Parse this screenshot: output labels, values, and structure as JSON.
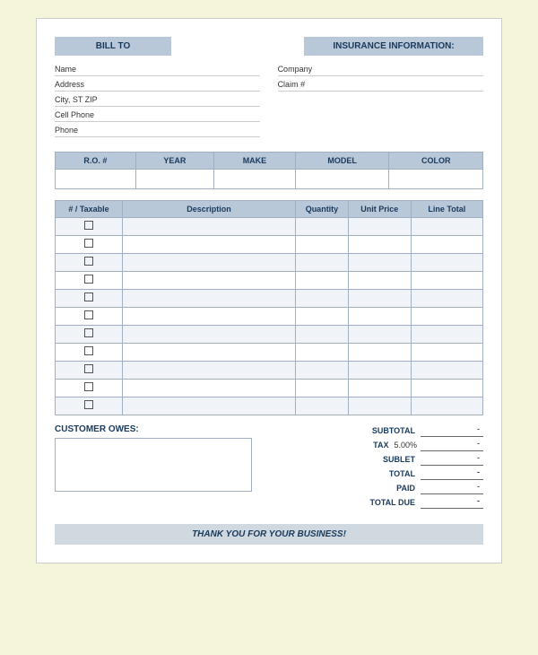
{
  "header": {
    "bill_to_label": "BILL TO",
    "insurance_label": "INSURANCE INFORMATION:"
  },
  "bill_to_fields": [
    {
      "label": "Name"
    },
    {
      "label": "Address"
    },
    {
      "label": "City, ST ZIP"
    },
    {
      "label": "Cell Phone"
    },
    {
      "label": "Phone"
    }
  ],
  "insurance_fields": [
    {
      "label": "Company"
    },
    {
      "label": "Claim #"
    }
  ],
  "vehicle_table": {
    "headers": [
      "R.O. #",
      "YEAR",
      "MAKE",
      "MODEL",
      "COLOR"
    ]
  },
  "items_table": {
    "headers": [
      "# / Taxable",
      "Description",
      "Quantity",
      "Unit Price",
      "Line Total"
    ],
    "rows": 11
  },
  "totals": {
    "subtotal_label": "SUBTOTAL",
    "subtotal_value": "-",
    "tax_label": "TAX",
    "tax_rate": "5.00%",
    "tax_value": "-",
    "sublet_label": "SUBLET",
    "sublet_value": "-",
    "total_label": "TOTAL",
    "total_value": "-",
    "paid_label": "PAID",
    "paid_value": "-",
    "total_due_label": "TOTAL DUE",
    "total_due_value": "-"
  },
  "customer_owes_label": "CUSTOMER OWES:",
  "footer_text": "THANK YOU FOR YOUR BUSINESS!"
}
